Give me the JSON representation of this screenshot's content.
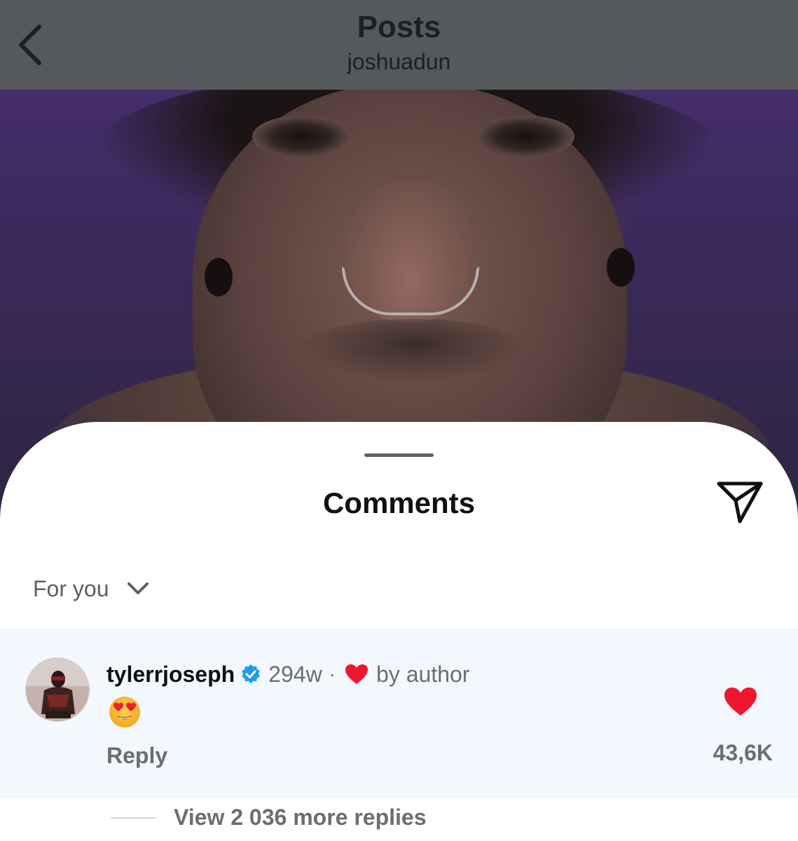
{
  "header": {
    "title": "Posts",
    "subtitle": "joshuadun",
    "back_icon": "chevron-left-icon",
    "background": "#56595c"
  },
  "post_image": {
    "description": "photo"
  },
  "comments_sheet": {
    "title": "Comments",
    "share_icon": "paper-plane-icon",
    "sort": {
      "label": "For you",
      "icon": "chevron-down-icon"
    }
  },
  "comment": {
    "username": "tylerrjoseph",
    "verified_icon": "verified-badge-icon",
    "time": "294w",
    "separator": "·",
    "liked_by_author_icon": "heart-icon",
    "liked_by_author_text": "by author",
    "text_emoji": "smiling-face-with-heart-eyes-icon",
    "reply_label": "Reply",
    "like_icon": "heart-filled-icon",
    "like_count": "43,6K",
    "background": "#f2f8fd",
    "heart_color": "#f0162f",
    "verified_color": "#1d9bf0"
  },
  "replies": {
    "label": "View 2 036 more replies"
  }
}
